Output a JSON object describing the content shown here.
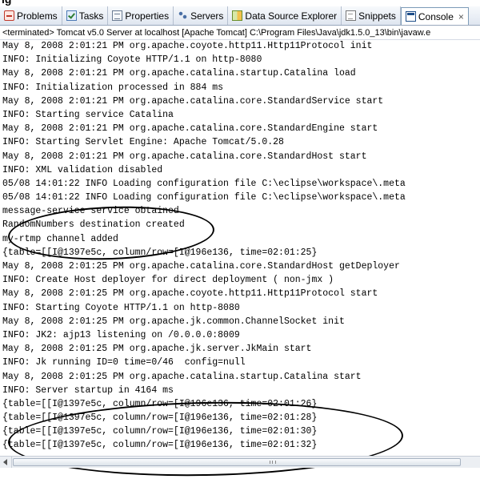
{
  "title_fragment": "ig",
  "tabs": [
    {
      "label": "Problems",
      "icon": "problems-icon",
      "active": false
    },
    {
      "label": "Tasks",
      "icon": "tasks-icon",
      "active": false
    },
    {
      "label": "Properties",
      "icon": "properties-icon",
      "active": false
    },
    {
      "label": "Servers",
      "icon": "servers-icon",
      "active": false
    },
    {
      "label": "Data Source Explorer",
      "icon": "datasource-icon",
      "active": false
    },
    {
      "label": "Snippets",
      "icon": "snippets-icon",
      "active": false
    },
    {
      "label": "Console",
      "icon": "console-icon",
      "active": true,
      "close": "×"
    }
  ],
  "status": "<terminated> Tomcat v5.0 Server at localhost [Apache Tomcat] C:\\Program Files\\Java\\jdk1.5.0_13\\bin\\javaw.e",
  "console_lines": [
    "May 8, 2008 2:01:21 PM org.apache.coyote.http11.Http11Protocol init",
    "INFO: Initializing Coyote HTTP/1.1 on http-8080",
    "May 8, 2008 2:01:21 PM org.apache.catalina.startup.Catalina load",
    "INFO: Initialization processed in 884 ms",
    "May 8, 2008 2:01:21 PM org.apache.catalina.core.StandardService start",
    "INFO: Starting service Catalina",
    "May 8, 2008 2:01:21 PM org.apache.catalina.core.StandardEngine start",
    "INFO: Starting Servlet Engine: Apache Tomcat/5.0.28",
    "May 8, 2008 2:01:21 PM org.apache.catalina.core.StandardHost start",
    "INFO: XML validation disabled",
    "05/08 14:01:22 INFO Loading configuration file C:\\eclipse\\workspace\\.meta",
    "05/08 14:01:22 INFO Loading configuration file C:\\eclipse\\workspace\\.meta",
    "message-service service obtained",
    "RandomNumbers destination created",
    "my-rtmp channel added",
    "{table=[[I@1397e5c, column/row=[I@196e136, time=02:01:25}",
    "May 8, 2008 2:01:25 PM org.apache.catalina.core.StandardHost getDeployer",
    "INFO: Create Host deployer for direct deployment ( non-jmx )",
    "May 8, 2008 2:01:25 PM org.apache.coyote.http11.Http11Protocol start",
    "INFO: Starting Coyote HTTP/1.1 on http-8080",
    "May 8, 2008 2:01:25 PM org.apache.jk.common.ChannelSocket init",
    "INFO: JK2: ajp13 listening on /0.0.0.0:8009",
    "May 8, 2008 2:01:25 PM org.apache.jk.server.JkMain start",
    "INFO: Jk running ID=0 time=0/46  config=null",
    "May 8, 2008 2:01:25 PM org.apache.catalina.startup.Catalina start",
    "INFO: Server startup in 4164 ms",
    "{table=[[I@1397e5c, column/row=[I@196e136, time=02:01:26}",
    "{table=[[I@1397e5c, column/row=[I@196e136, time=02:01:28}",
    "{table=[[I@1397e5c, column/row=[I@196e136, time=02:01:30}",
    "{table=[[I@1397e5c, column/row=[I@196e136, time=02:01:32}"
  ]
}
